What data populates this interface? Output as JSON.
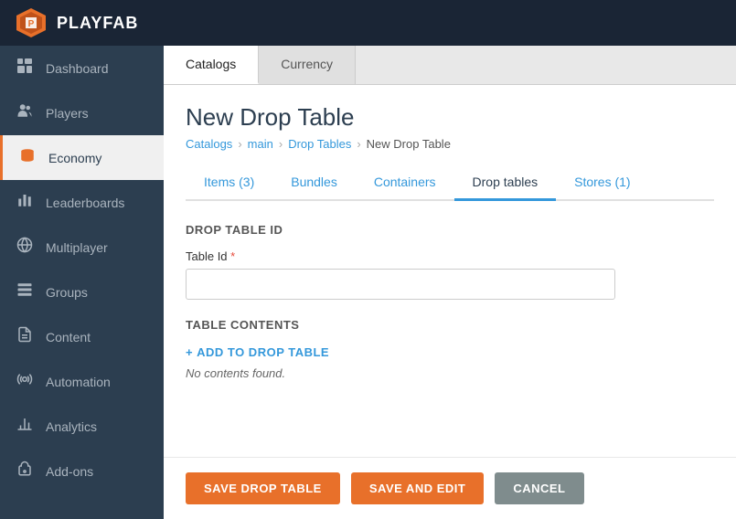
{
  "app": {
    "name": "PLAYFAB"
  },
  "sidebar": {
    "items": [
      {
        "id": "dashboard",
        "label": "Dashboard",
        "icon": "📊"
      },
      {
        "id": "players",
        "label": "Players",
        "icon": "👥"
      },
      {
        "id": "economy",
        "label": "Economy",
        "icon": "💾",
        "active": true
      },
      {
        "id": "leaderboards",
        "label": "Leaderboards",
        "icon": "🏆"
      },
      {
        "id": "multiplayer",
        "label": "Multiplayer",
        "icon": "🌐"
      },
      {
        "id": "groups",
        "label": "Groups",
        "icon": "📋"
      },
      {
        "id": "content",
        "label": "Content",
        "icon": "📄"
      },
      {
        "id": "automation",
        "label": "Automation",
        "icon": "🤖"
      },
      {
        "id": "analytics",
        "label": "Analytics",
        "icon": "📈"
      },
      {
        "id": "add-ons",
        "label": "Add-ons",
        "icon": "🔧"
      }
    ]
  },
  "top_tabs": [
    {
      "id": "catalogs",
      "label": "Catalogs",
      "active": true
    },
    {
      "id": "currency",
      "label": "Currency"
    }
  ],
  "page": {
    "title": "New Drop Table",
    "breadcrumb": {
      "items": [
        {
          "id": "catalogs",
          "label": "Catalogs",
          "link": true
        },
        {
          "id": "main",
          "label": "main",
          "link": true
        },
        {
          "id": "drop-tables",
          "label": "Drop Tables",
          "link": true
        },
        {
          "id": "current",
          "label": "New Drop Table",
          "link": false
        }
      ]
    }
  },
  "sub_tabs": [
    {
      "id": "items",
      "label": "Items (3)"
    },
    {
      "id": "bundles",
      "label": "Bundles"
    },
    {
      "id": "containers",
      "label": "Containers"
    },
    {
      "id": "drop-tables",
      "label": "Drop tables",
      "active": true
    },
    {
      "id": "stores",
      "label": "Stores (1)"
    }
  ],
  "form": {
    "drop_table_id_label": "DROP TABLE ID",
    "table_id_label": "Table Id",
    "table_id_placeholder": "",
    "table_contents_label": "TABLE CONTENTS",
    "add_to_drop_label": "ADD TO DROP TABLE",
    "no_contents_text": "No contents found."
  },
  "buttons": {
    "save_drop_table": "SAVE DROP TABLE",
    "save_and_edit": "SAVE AND EDIT",
    "cancel": "CANCEL"
  }
}
